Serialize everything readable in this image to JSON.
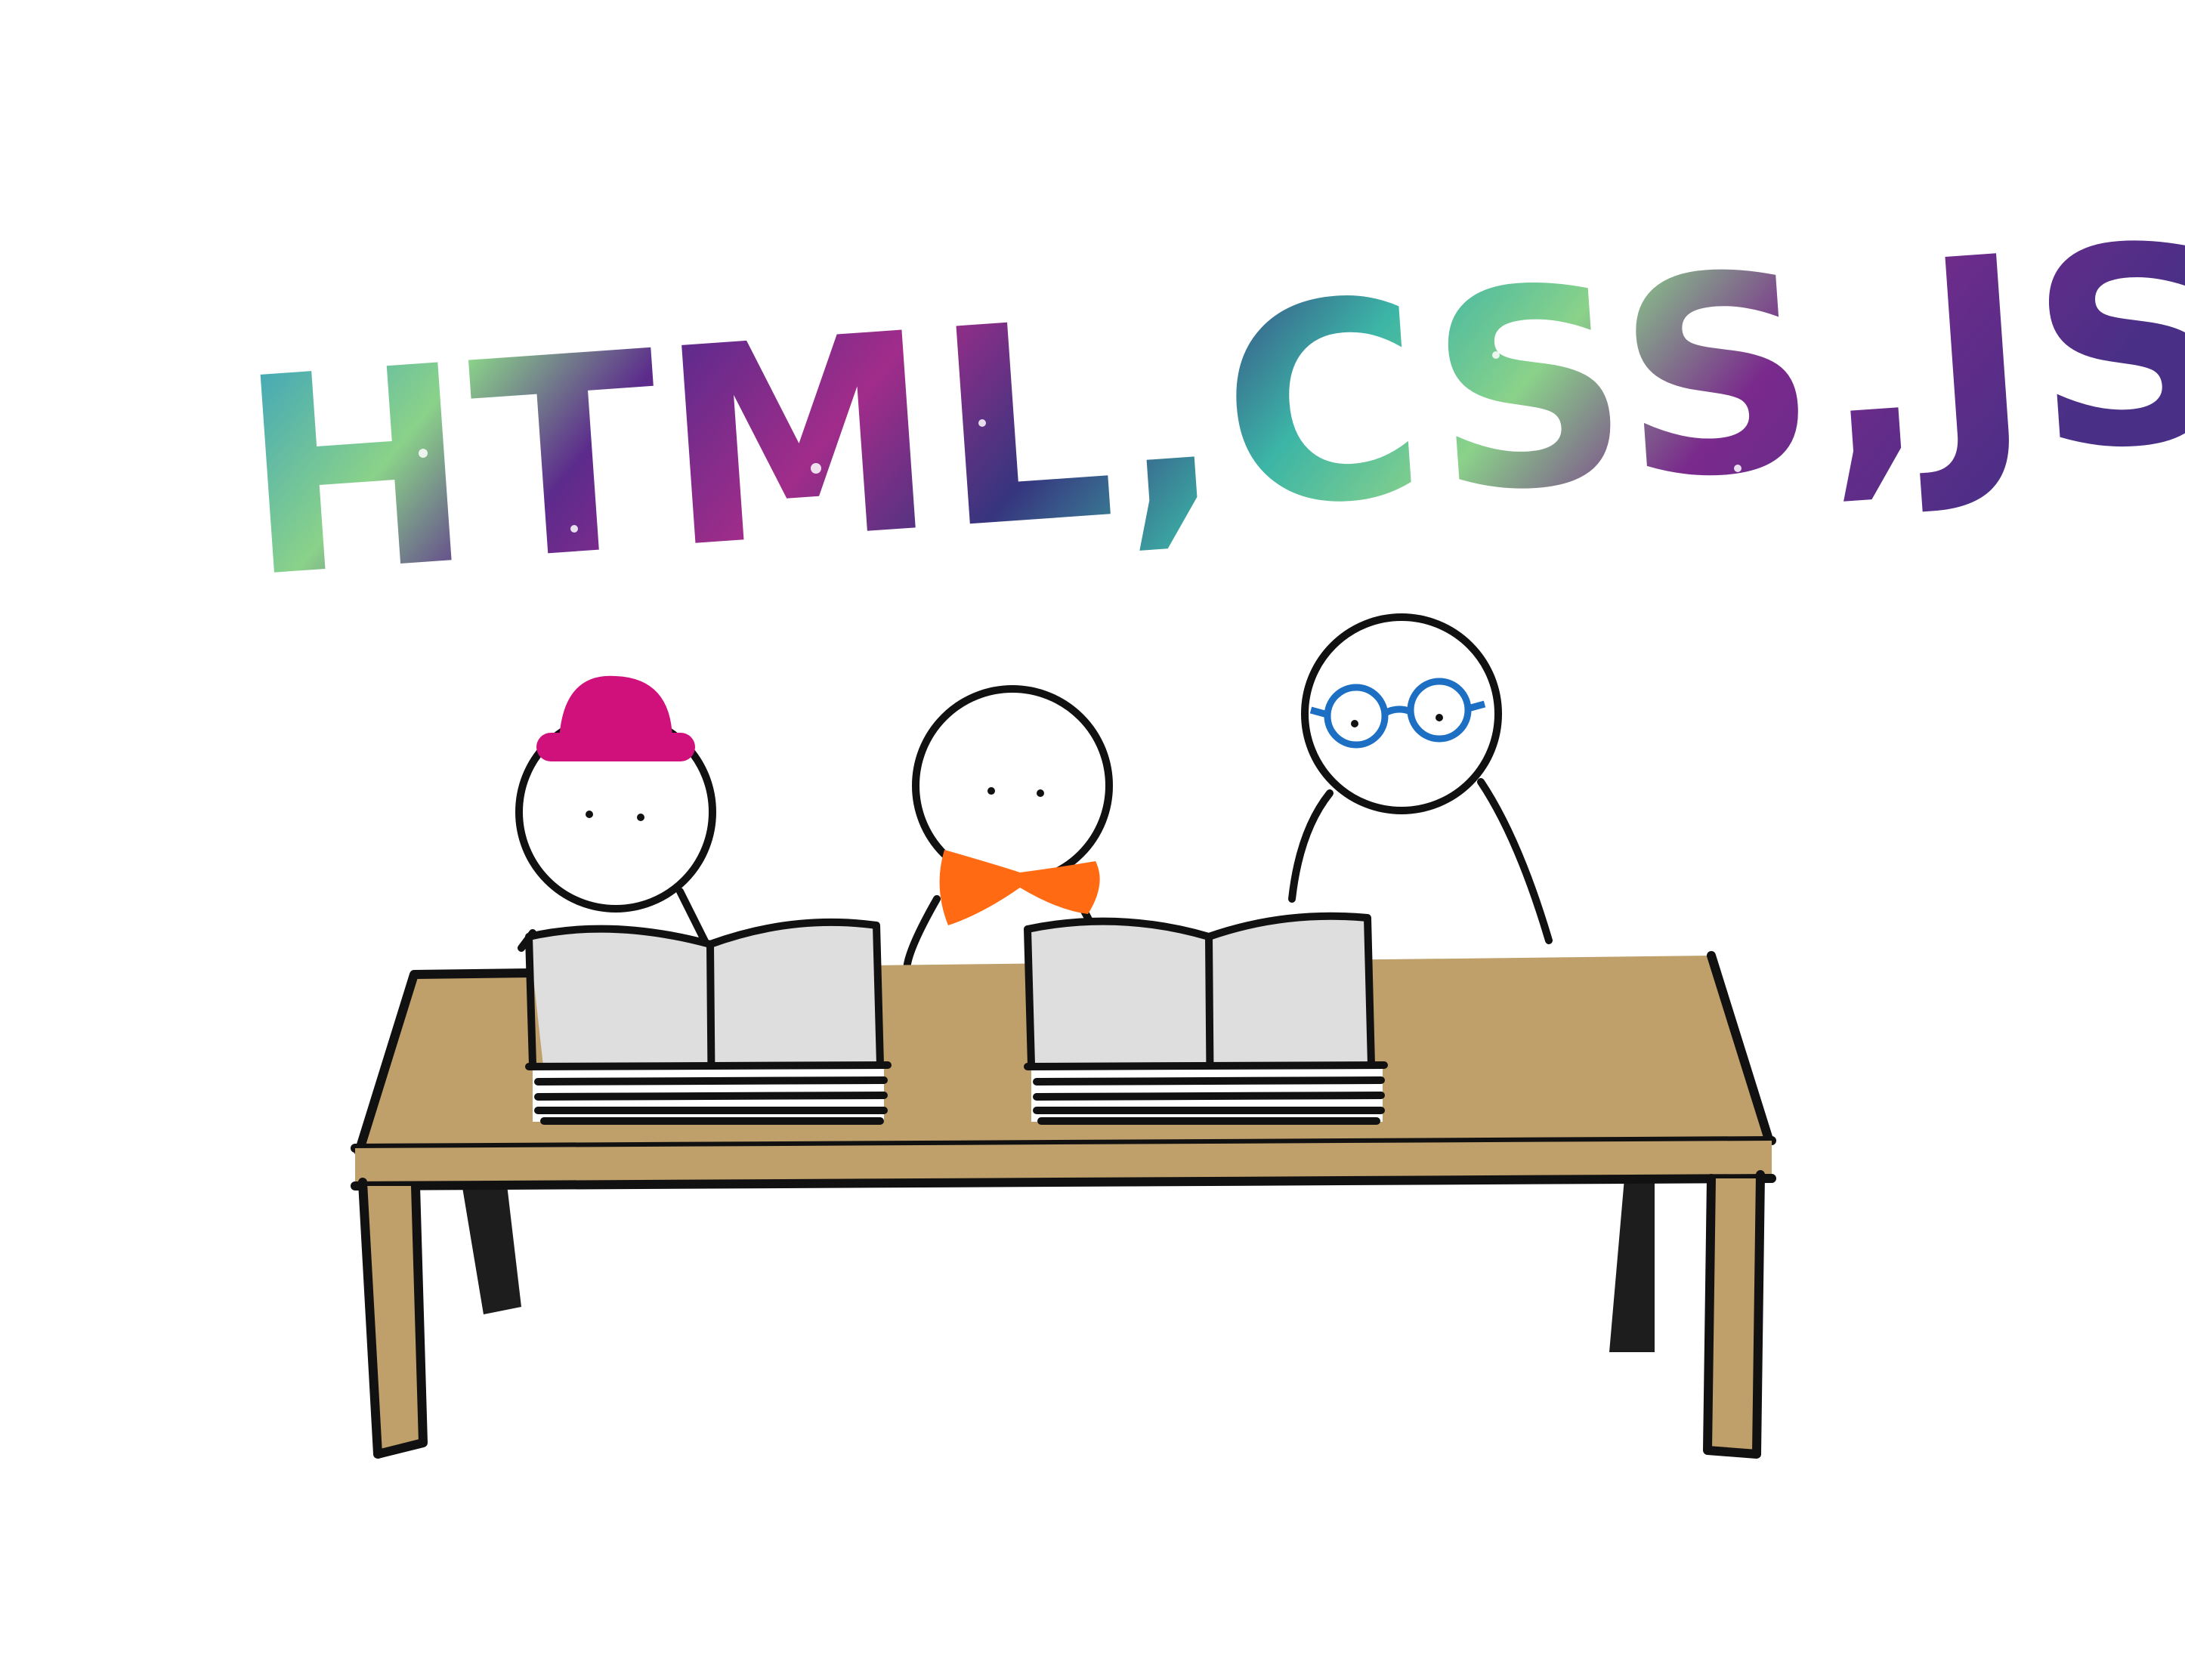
{
  "title": {
    "text": "HTML,CSS,JS"
  },
  "colors": {
    "hat": "#d0117c",
    "bow_tie": "#ff6a13",
    "glasses": "#1c6fc2",
    "table": "#bf9f6a",
    "page": "#dedede",
    "ink": "#111111",
    "glitter": [
      "#2f9cc4",
      "#8ad28a",
      "#6a2a8c",
      "#a12c8a",
      "#36357e",
      "#3cb5a6"
    ]
  },
  "figures": [
    {
      "name": "figure-with-hat",
      "accessory": "hat-icon"
    },
    {
      "name": "figure-with-bow-tie",
      "accessory": "bow-tie-icon"
    },
    {
      "name": "figure-with-glasses",
      "accessory": "glasses-icon"
    }
  ],
  "objects": [
    "open-book-icon",
    "open-book-icon",
    "table-icon"
  ]
}
